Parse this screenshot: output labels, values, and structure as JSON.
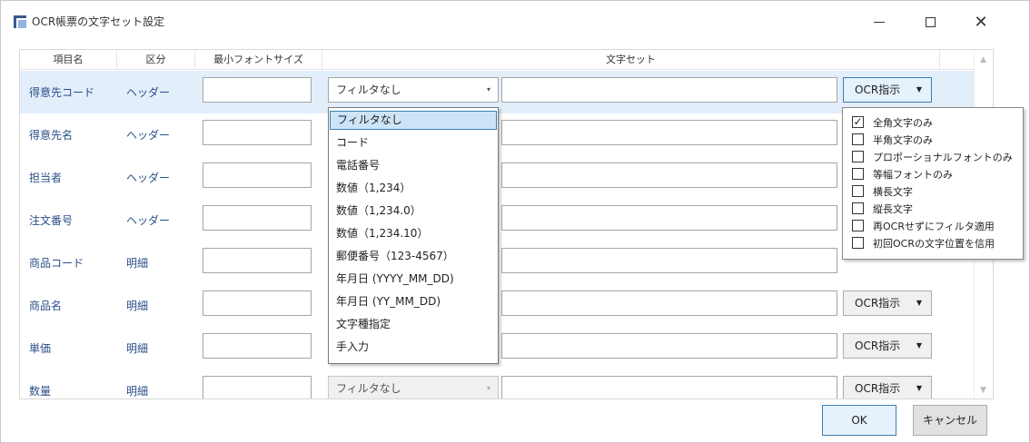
{
  "window": {
    "title": "OCR帳票の文字セット設定",
    "minimize": "—",
    "maximize": "□",
    "close": "✕"
  },
  "grid": {
    "columns": [
      "項目名",
      "区分",
      "最小フォントサイズ",
      "文字セット"
    ],
    "rows": [
      {
        "name": "得意先コード",
        "kubun": "ヘッダー",
        "filter": "フィルタなし",
        "ocr": "OCR指示"
      },
      {
        "name": "得意先名",
        "kubun": "ヘッダー",
        "filter": "",
        "ocr": ""
      },
      {
        "name": "担当者",
        "kubun": "ヘッダー",
        "filter": "",
        "ocr": ""
      },
      {
        "name": "注文番号",
        "kubun": "ヘッダー",
        "filter": "",
        "ocr": ""
      },
      {
        "name": "商品コード",
        "kubun": "明細",
        "filter": "",
        "ocr": ""
      },
      {
        "name": "商品名",
        "kubun": "明細",
        "filter": "",
        "ocr": "OCR指示"
      },
      {
        "name": "単価",
        "kubun": "明細",
        "filter": "",
        "ocr": "OCR指示"
      },
      {
        "name": "数量",
        "kubun": "明細",
        "filter": "フィルタなし",
        "ocr": "OCR指示"
      }
    ]
  },
  "dropdown": {
    "items": [
      "フィルタなし",
      "コード",
      "電話番号",
      "数値（1,234）",
      "数値（1,234.0）",
      "数値（1,234.10）",
      "郵便番号（123-4567）",
      "年月日 (YYYY_MM_DD)",
      "年月日 (YY_MM_DD)",
      "文字種指定",
      "手入力"
    ],
    "selected_index": 0
  },
  "ocr_popup": {
    "options": [
      {
        "label": "全角文字のみ",
        "checked": true
      },
      {
        "label": "半角文字のみ",
        "checked": false
      },
      {
        "label": "プロポーショナルフォントのみ",
        "checked": false
      },
      {
        "label": "等幅フォントのみ",
        "checked": false
      },
      {
        "label": "横長文字",
        "checked": false
      },
      {
        "label": "縦長文字",
        "checked": false
      },
      {
        "label": "再OCRせずにフィルタ適用",
        "checked": false
      },
      {
        "label": "初回OCRの文字位置を信用",
        "checked": false
      }
    ]
  },
  "footer": {
    "ok_label": "OK",
    "cancel_label": "キャンセル"
  },
  "icons": {
    "dropdown_arrow": "▾",
    "check_mark": "✓",
    "scroll_up": "▲",
    "scroll_down": "▼"
  }
}
